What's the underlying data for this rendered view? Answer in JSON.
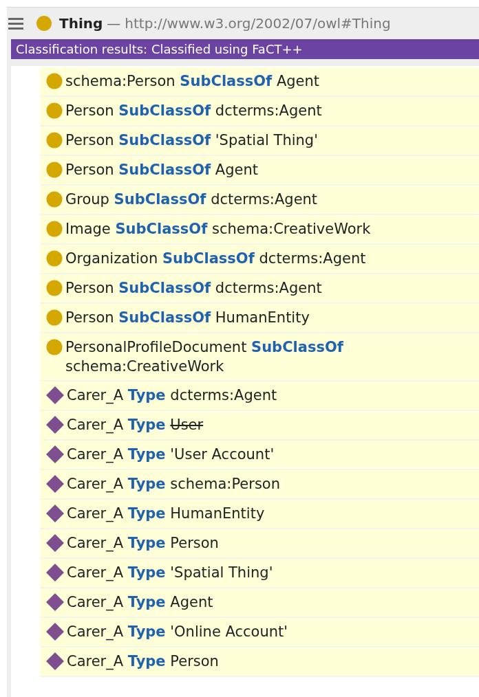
{
  "header": {
    "entity": "Thing",
    "separator": "—",
    "iri": "http://www.w3.org/2002/07/owl#Thing"
  },
  "status_bar": {
    "text": "Classification results: Classified using FaCT++"
  },
  "axioms": [
    {
      "kind": "class",
      "subject": "schema:Person",
      "relation": "SubClassOf",
      "object": "Agent",
      "struck": false
    },
    {
      "kind": "class",
      "subject": "Person",
      "relation": "SubClassOf",
      "object": "dcterms:Agent",
      "struck": false
    },
    {
      "kind": "class",
      "subject": "Person",
      "relation": "SubClassOf",
      "object": "'Spatial Thing'",
      "struck": false
    },
    {
      "kind": "class",
      "subject": "Person",
      "relation": "SubClassOf",
      "object": "Agent",
      "struck": false
    },
    {
      "kind": "class",
      "subject": "Group",
      "relation": "SubClassOf",
      "object": "dcterms:Agent",
      "struck": false
    },
    {
      "kind": "class",
      "subject": "Image",
      "relation": "SubClassOf",
      "object": "schema:CreativeWork",
      "struck": false
    },
    {
      "kind": "class",
      "subject": "Organization",
      "relation": "SubClassOf",
      "object": "dcterms:Agent",
      "struck": false
    },
    {
      "kind": "class",
      "subject": "Person",
      "relation": "SubClassOf",
      "object": "dcterms:Agent",
      "struck": false
    },
    {
      "kind": "class",
      "subject": "Person",
      "relation": "SubClassOf",
      "object": "HumanEntity",
      "struck": false
    },
    {
      "kind": "class",
      "subject": "PersonalProfileDocument",
      "relation": "SubClassOf",
      "object": "schema:CreativeWork",
      "struck": false
    },
    {
      "kind": "individual",
      "subject": "Carer_A",
      "relation": "Type",
      "object": "dcterms:Agent",
      "struck": false
    },
    {
      "kind": "individual",
      "subject": "Carer_A",
      "relation": "Type",
      "object": "User",
      "struck": true
    },
    {
      "kind": "individual",
      "subject": "Carer_A",
      "relation": "Type",
      "object": "'User Account'",
      "struck": false
    },
    {
      "kind": "individual",
      "subject": "Carer_A",
      "relation": "Type",
      "object": "schema:Person",
      "struck": false
    },
    {
      "kind": "individual",
      "subject": "Carer_A",
      "relation": "Type",
      "object": "HumanEntity",
      "struck": false
    },
    {
      "kind": "individual",
      "subject": "Carer_A",
      "relation": "Type",
      "object": "Person",
      "struck": false
    },
    {
      "kind": "individual",
      "subject": "Carer_A",
      "relation": "Type",
      "object": "'Spatial Thing'",
      "struck": false
    },
    {
      "kind": "individual",
      "subject": "Carer_A",
      "relation": "Type",
      "object": "Agent",
      "struck": false
    },
    {
      "kind": "individual",
      "subject": "Carer_A",
      "relation": "Type",
      "object": "'Online Account'",
      "struck": false
    },
    {
      "kind": "individual",
      "subject": "Carer_A",
      "relation": "Type",
      "object": "Person",
      "struck": false
    }
  ]
}
